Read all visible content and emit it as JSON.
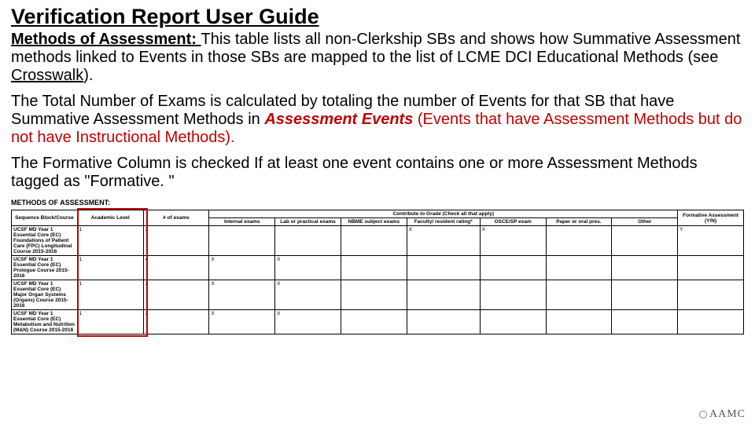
{
  "title": "Verification Report User Guide",
  "para1": {
    "lead": "Methods of Assessment: ",
    "body_a": "This table lists all non-Clerkship SBs and shows how Summative Assessment methods linked to Events in those SBs are mapped to the list of LCME DCI Educational Methods (see ",
    "crosswalk": "Crosswalk",
    "body_b": ")."
  },
  "para2": {
    "a": "The Total Number of Exams is calculated by totaling the number of Events for that SB that have Summative Assessment Methods in ",
    "em": "Assessment Events",
    "b": " (Events that have Assessment Methods but do not have Instructional Methods)."
  },
  "para3": "The Formative Column is checked If at least one event contains one or more Assessment Methods tagged as \"Formative. \"",
  "moa_header": "METHODS OF ASSESSMENT:",
  "table": {
    "group_header": "Contribute to Grade (Check all that apply)",
    "cols": {
      "c1": "Sequence Block/Course",
      "c2": "Academic Level",
      "c3": "# of exams",
      "c4": "Internal exams",
      "c5": "Lab or practical exams",
      "c6": "NBME subject exams",
      "c7": "Faculty/ resident rating*",
      "c8": "OSCE/SP exam",
      "c9": "Paper or oral pres.",
      "c10": "Other",
      "c11": "Formative Assessment (Y/N)"
    },
    "rows": [
      {
        "course": "UCSF MD Year 1 Essential Core (EC) Foundations of Patient Care (FPC) Longitudinal Course 2015-2016",
        "level": "1",
        "exams": "2",
        "c4": "",
        "c5": "",
        "c6": "",
        "c7": "X",
        "c8": "X",
        "c9": "",
        "c10": "",
        "c11": "Y"
      },
      {
        "course": "UCSF MD Year 1 Essential Core (EC) Prologue Course 2015-2016",
        "level": "1",
        "exams": "4",
        "c4": "X",
        "c5": "X",
        "c6": "",
        "c7": "",
        "c8": "",
        "c9": "",
        "c10": "",
        "c11": ""
      },
      {
        "course": "UCSF MD Year 1 Essential Core (EC) Major Organ Systems (Organs) Course 2015-2016",
        "level": "1",
        "exams": "3",
        "c4": "X",
        "c5": "X",
        "c6": "",
        "c7": "",
        "c8": "",
        "c9": "",
        "c10": "",
        "c11": ""
      },
      {
        "course": "UCSF MD Year 1 Essential Core (EC) Metabolism and Nutrition (M&N) Course 2015-2016",
        "level": "1",
        "exams": "3",
        "c4": "X",
        "c5": "X",
        "c6": "",
        "c7": "",
        "c8": "",
        "c9": "",
        "c10": "",
        "c11": ""
      }
    ]
  },
  "footer_brand": "AAMC"
}
